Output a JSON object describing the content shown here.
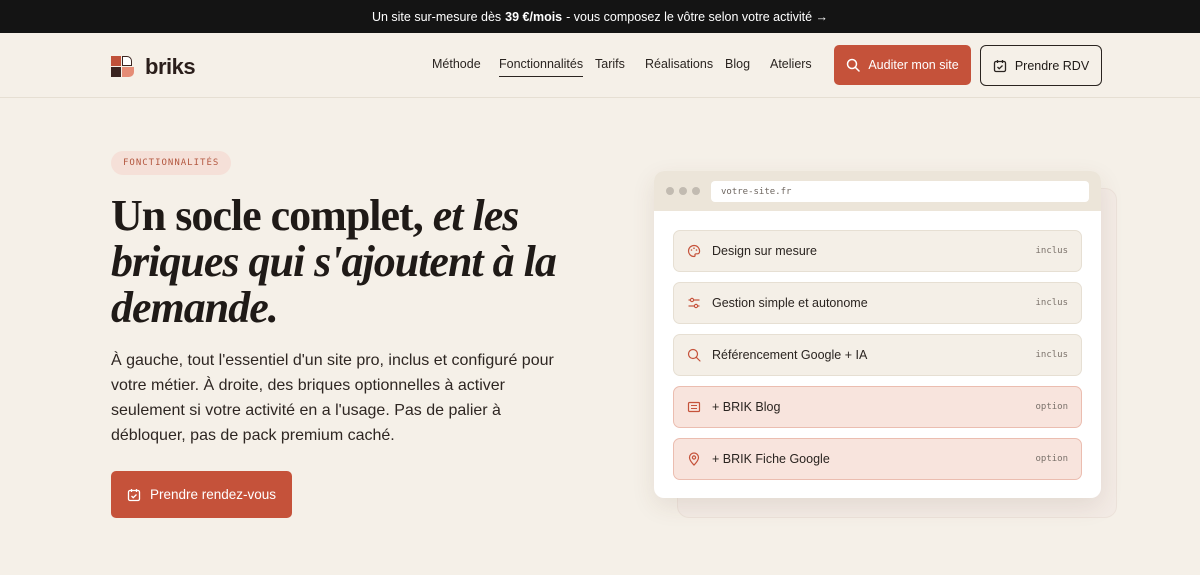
{
  "announcement": {
    "text_before": "Un site sur-mesure dès",
    "price": "39 €/mois",
    "text_after": "- vous composez le vôtre selon votre activité →"
  },
  "brand": {
    "name": "briks"
  },
  "nav": {
    "items": [
      "Méthode",
      "Fonctionnalités",
      "Tarifs",
      "Réalisations",
      "Blog",
      "Ateliers"
    ],
    "active": "Fonctionnalités"
  },
  "header_buttons": {
    "audit": "Auditer mon site",
    "rdv": "Prendre RDV"
  },
  "hero": {
    "eyebrow": "FONCTIONNALITÉS",
    "headline_regular": "Un socle complet,",
    "headline_italic": "et les briques qui s'ajoutent à la demande.",
    "paragraph": "À gauche, tout l'essentiel d'un site pro, inclus et configuré pour votre métier. À droite, des briques optionnelles à activer seulement si votre activité en a l'usage. Pas de palier à débloquer, pas de pack premium caché.",
    "cta": "Prendre rendez-vous"
  },
  "mockup": {
    "url": "votre-site.fr",
    "features": [
      {
        "label": "Design sur mesure",
        "tag": "inclus",
        "icon": "palette-icon",
        "optional": false
      },
      {
        "label": "Gestion simple et autonome",
        "tag": "inclus",
        "icon": "sliders-icon",
        "optional": false
      },
      {
        "label": "Référencement Google + IA",
        "tag": "inclus",
        "icon": "search-icon",
        "optional": false
      },
      {
        "label": "+ BRIK Blog",
        "tag": "option",
        "icon": "article-icon",
        "optional": true
      },
      {
        "label": "+ BRIK Fiche Google",
        "tag": "option",
        "icon": "map-pin-icon",
        "optional": true
      }
    ]
  },
  "colors": {
    "accent": "#c5523a",
    "background": "#f5f0e8",
    "topbar": "#141414",
    "option_bg": "#f8e4dd"
  }
}
